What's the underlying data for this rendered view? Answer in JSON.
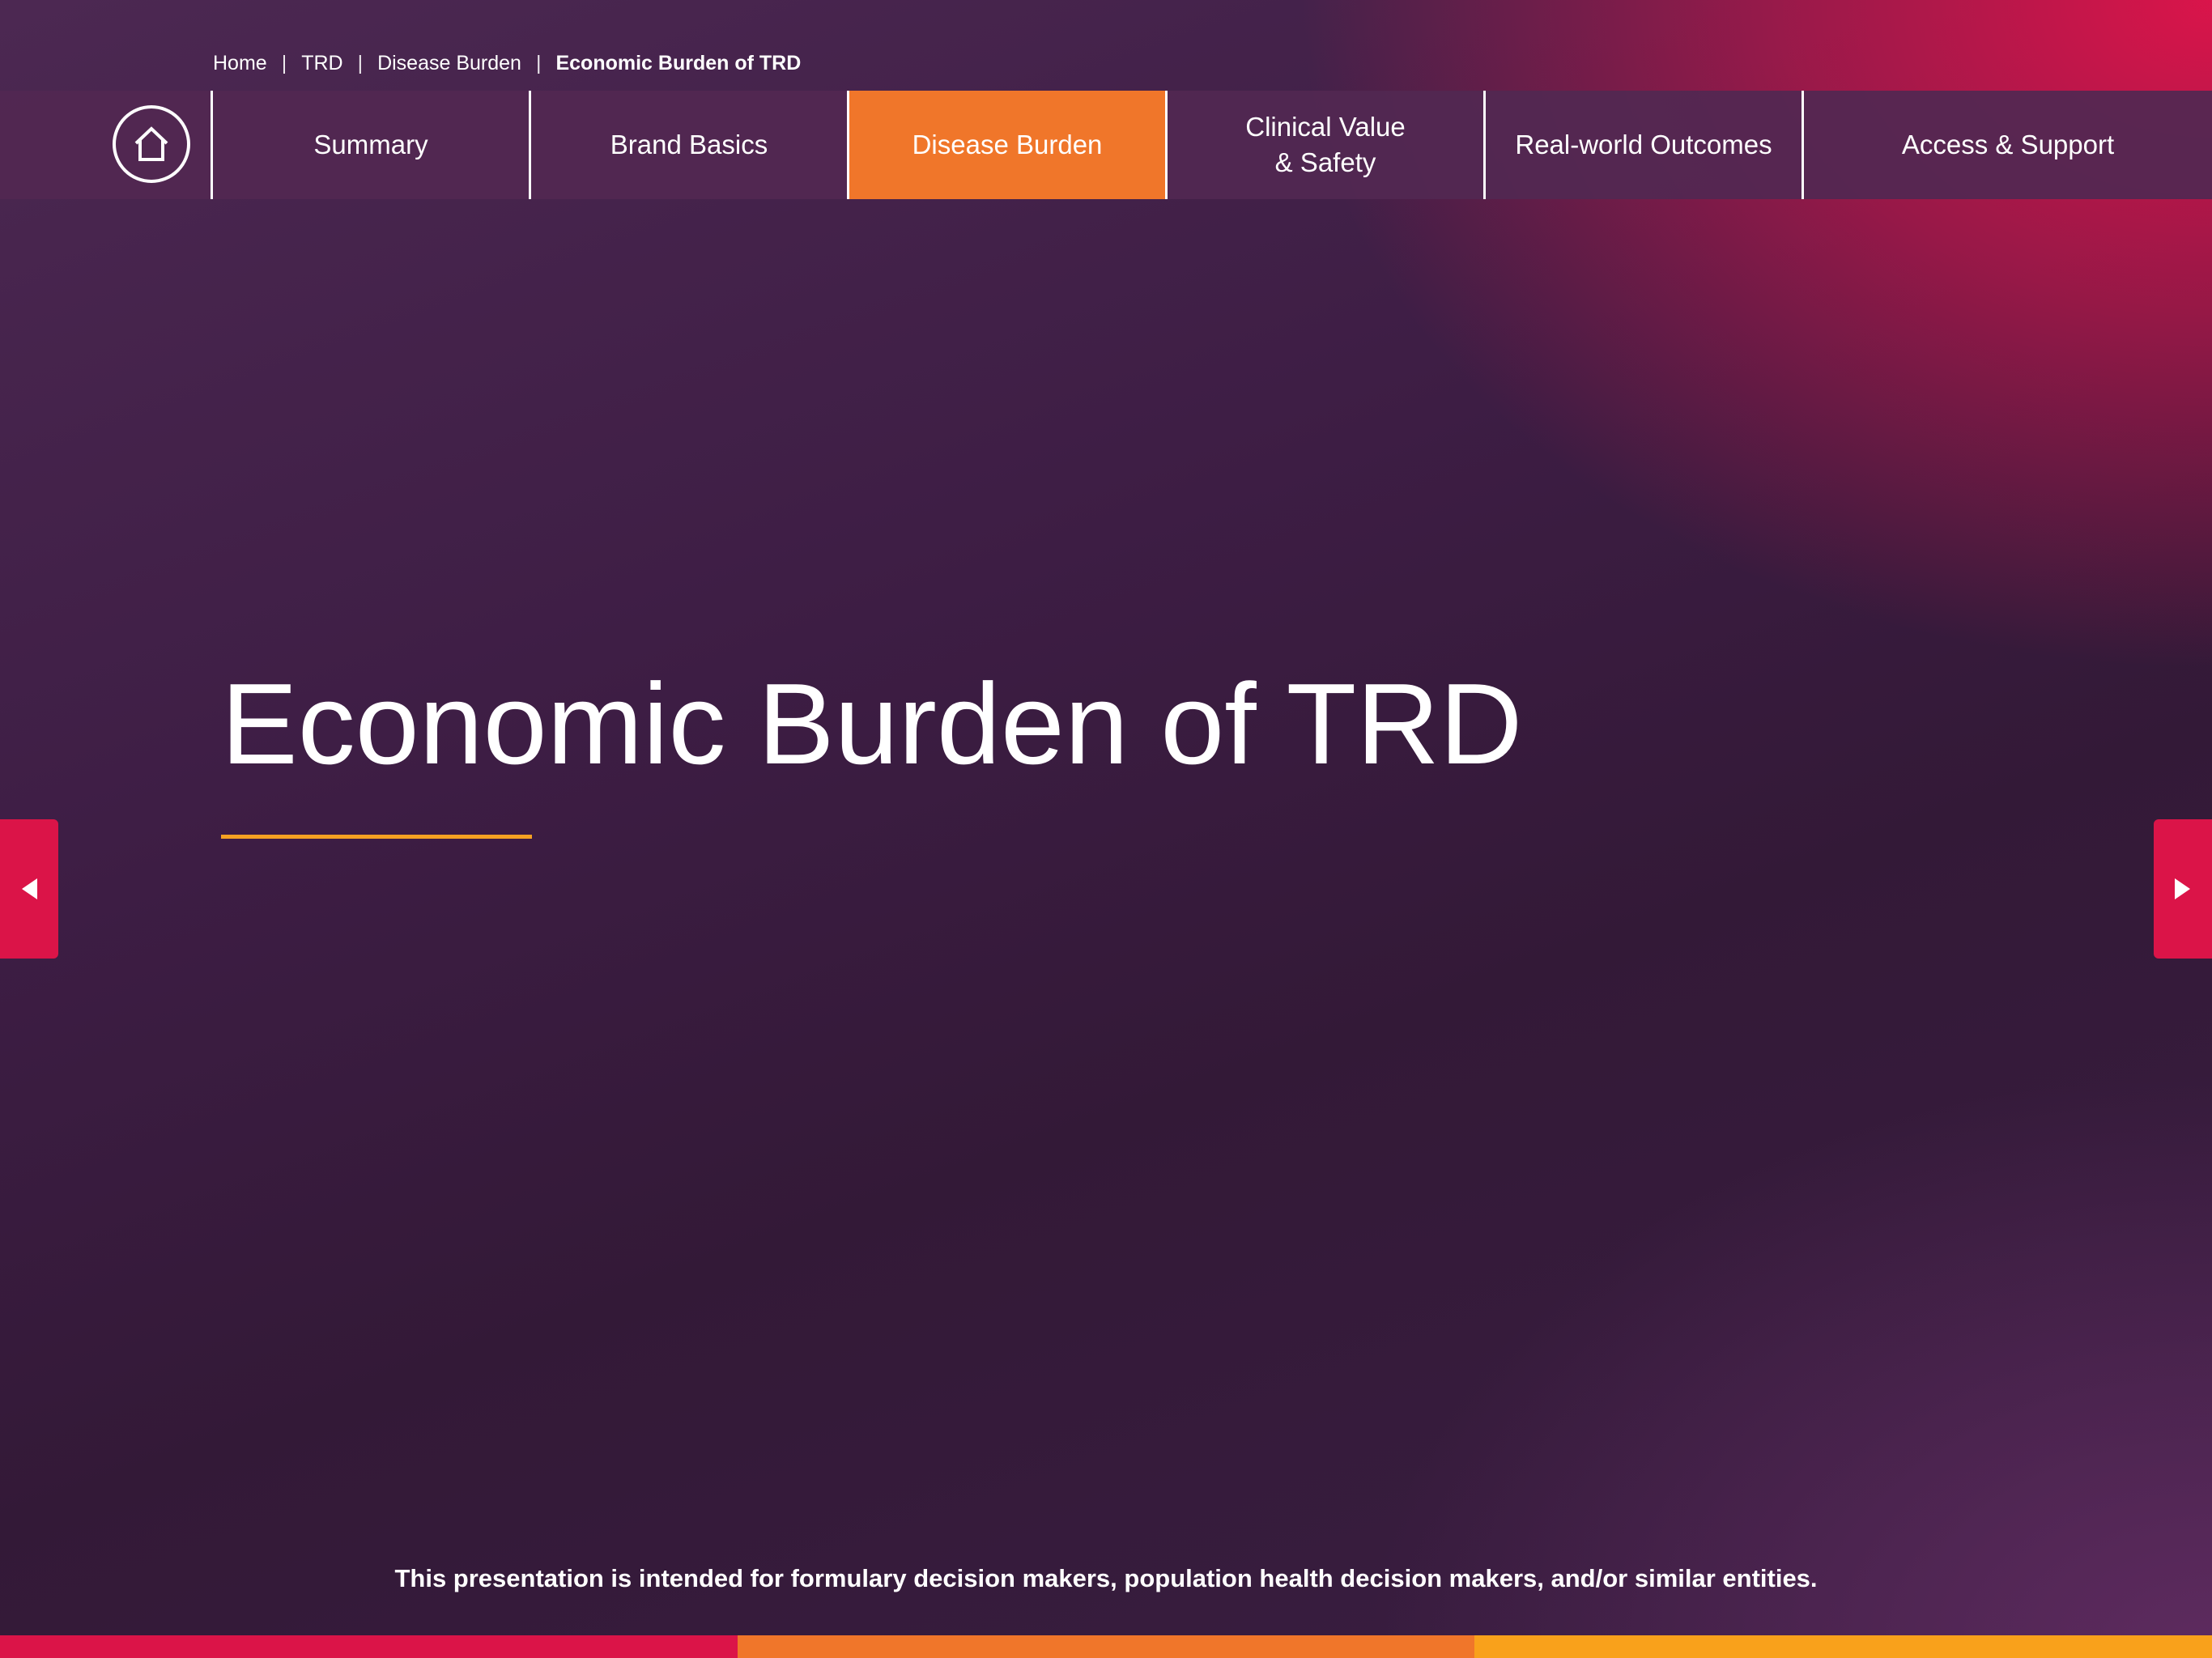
{
  "breadcrumb": {
    "items": [
      "Home",
      "TRD",
      "Disease Burden"
    ],
    "separator": "|",
    "current": "Economic Burden of TRD"
  },
  "nav": {
    "home_icon": "home-icon",
    "items": [
      {
        "label": "Summary",
        "active": false
      },
      {
        "label": "Brand Basics",
        "active": false
      },
      {
        "label": "Disease Burden",
        "active": true
      },
      {
        "label": "Clinical Value\n& Safety",
        "active": false
      },
      {
        "label": "Real-world Outcomes",
        "active": false
      },
      {
        "label": "Access & Support",
        "active": false
      }
    ]
  },
  "main": {
    "title": "Economic Burden of TRD"
  },
  "controls": {
    "prev_icon": "caret-left-icon",
    "next_icon": "caret-right-icon"
  },
  "footer": {
    "disclaimer": "This presentation is intended for formulary decision makers, population health decision makers, and/or similar entities."
  },
  "colors": {
    "accent_orange": "#f0762a",
    "accent_magenta": "#db1448",
    "accent_gold": "#f5a122",
    "stripe": [
      "#db1448",
      "#f0762a",
      "#f9a11b"
    ]
  }
}
